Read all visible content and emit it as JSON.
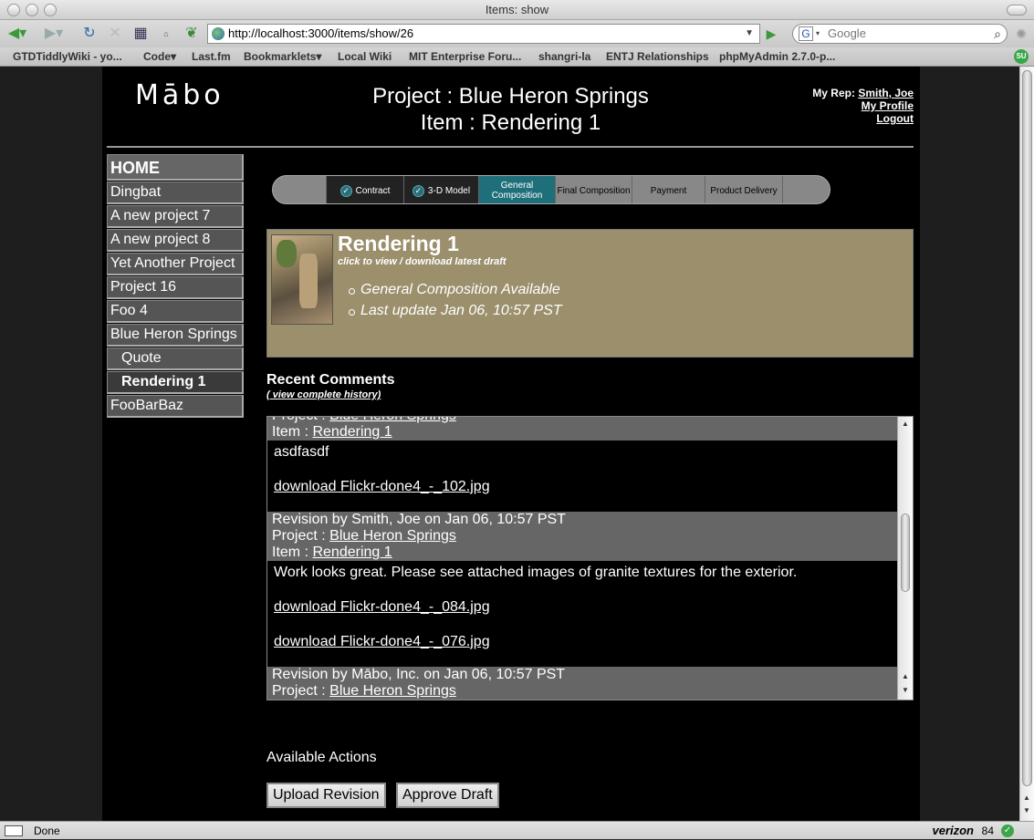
{
  "window": {
    "title": "Items: show"
  },
  "browser": {
    "url": "http://localhost:3000/items/show/26",
    "search_placeholder": "Google",
    "bookmarks": [
      "GTDTiddlyWiki - yo...",
      "Code▾",
      "Last.fm",
      "Bookmarklets▾",
      "Local Wiki",
      "MIT Enterprise Foru...",
      "shangri-la",
      "ENTJ Relationships",
      "phpMyAdmin 2.7.0-p..."
    ],
    "status": "Done",
    "status_brand": "verizon",
    "status_count": "84"
  },
  "header": {
    "logo": "Mābo",
    "project_line": "Project : Blue Heron Springs",
    "item_line": "Item : Rendering 1",
    "rep_label": "My Rep:",
    "rep_name": "Smith, Joe",
    "my_profile": "My Profile",
    "logout": "Logout"
  },
  "sidebar": {
    "items": [
      {
        "label": "Home"
      },
      {
        "label": "Dingbat"
      },
      {
        "label": "A new project 7"
      },
      {
        "label": "A new project 8"
      },
      {
        "label": "Yet Another Project"
      },
      {
        "label": "Project 16"
      },
      {
        "label": "Foo 4"
      },
      {
        "label": "Blue Heron Springs"
      },
      {
        "label": "Quote"
      },
      {
        "label": "Rendering 1"
      },
      {
        "label": "FooBarBaz"
      }
    ]
  },
  "progress": {
    "steps": [
      "Contract",
      "3-D Model",
      "General Composition",
      "Final Composition",
      "Payment",
      "Product Delivery"
    ],
    "current": "General Composition"
  },
  "item": {
    "title": "Rendering 1",
    "subtitle": "click to view / download latest draft",
    "status": "General Composition Available",
    "last_update": "Last update Jan 06, 10:57 PST"
  },
  "comments": {
    "title": "Recent Comments",
    "history_link": "( view complete history)",
    "project_label": "Project :",
    "item_label": "Item :",
    "project_name": "Blue Heron Springs",
    "item_name": "Rendering 1",
    "c1_body": "asdfasdf",
    "c1_download": "download Flickr-done4_-_102.jpg",
    "c2_head": "Revision by Smith, Joe on Jan 06, 10:57 PST",
    "c2_body": "Work looks great. Please see attached images of granite textures for the exterior.",
    "c2_download1": "download Flickr-done4_-_084.jpg",
    "c2_download2": "download Flickr-done4_-_076.jpg",
    "c3_head": "Revision by Mābo, Inc. on Jan 06, 10:57 PST"
  },
  "actions": {
    "title": "Available Actions",
    "upload": "Upload Revision",
    "approve": "Approve Draft"
  }
}
